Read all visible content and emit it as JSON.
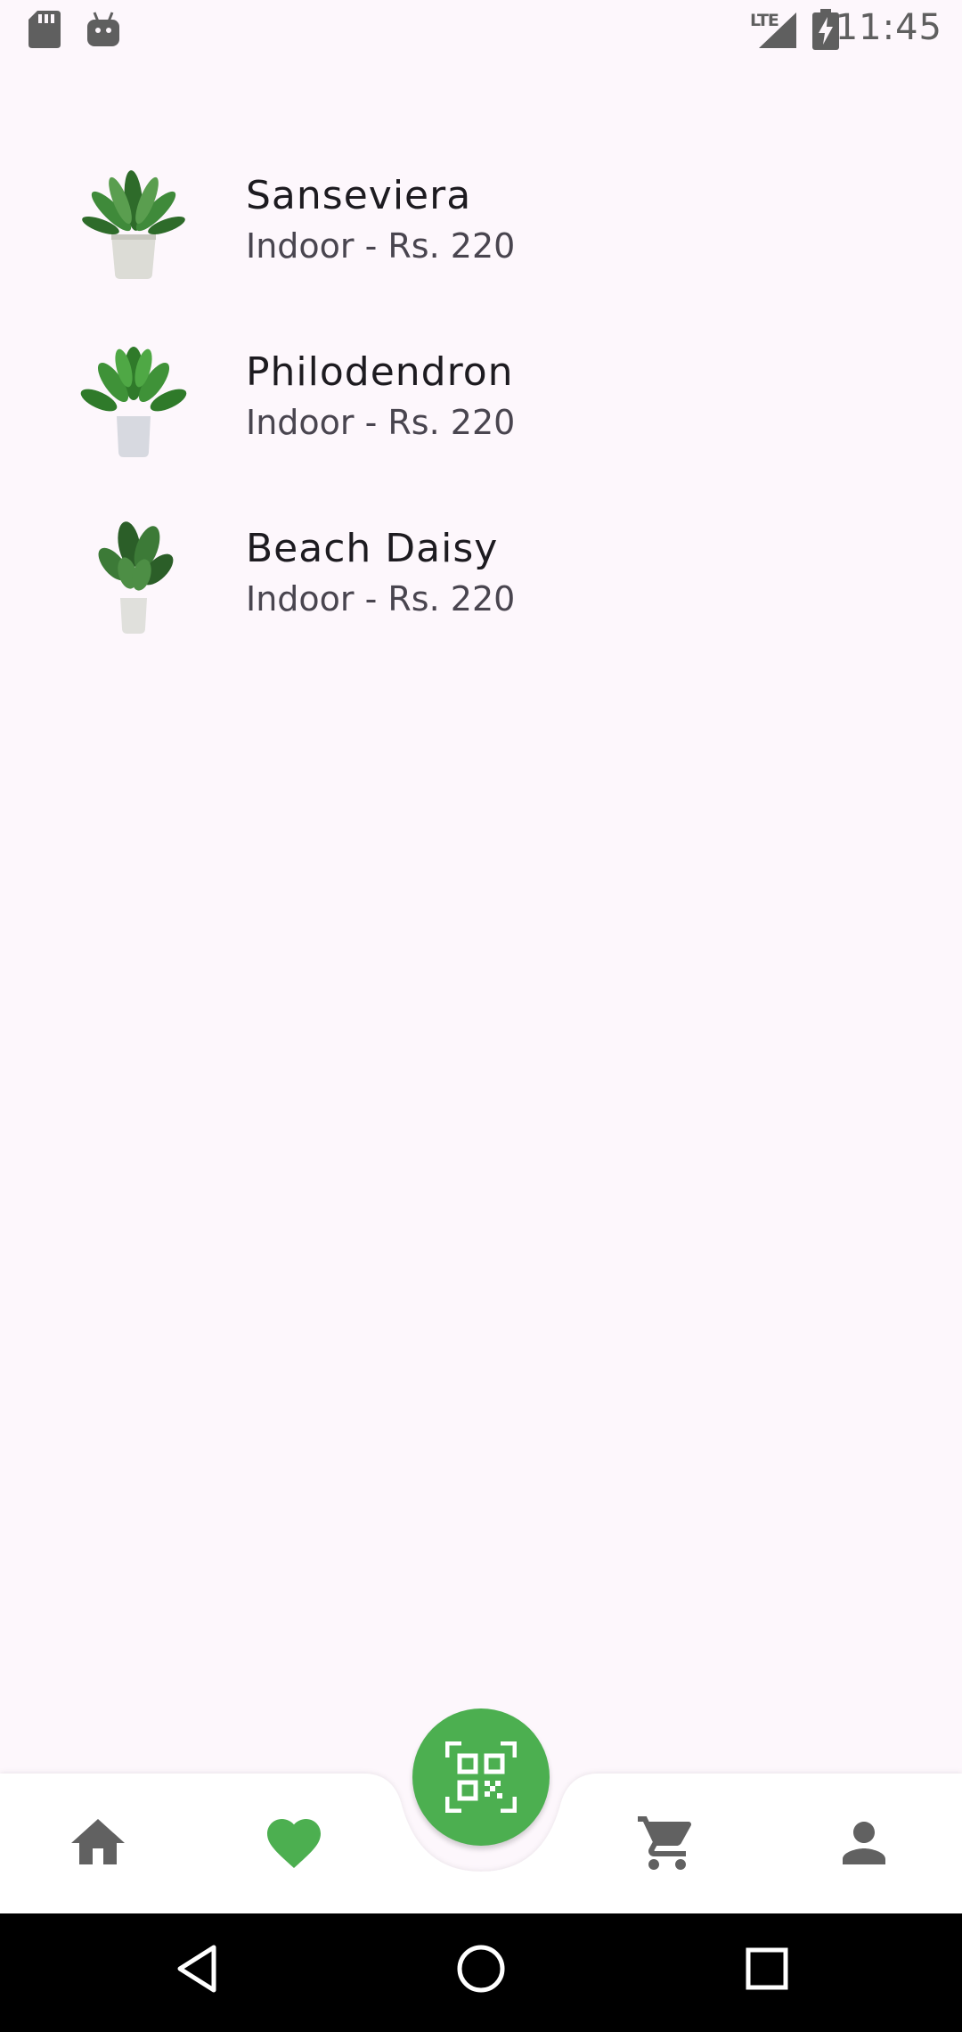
{
  "status_bar": {
    "time": "11:45",
    "network_label": "LTE",
    "icons": [
      "sd-card-icon",
      "android-debug-icon",
      "signal-icon",
      "battery-charging-icon"
    ]
  },
  "favorites": [
    {
      "name": "Sanseviera",
      "subtitle": "Indoor - Rs. 220",
      "image": "potted-plant-image"
    },
    {
      "name": "Philodendron",
      "subtitle": "Indoor - Rs. 220",
      "image": "potted-plant-image"
    },
    {
      "name": "Beach Daisy",
      "subtitle": "Indoor - Rs. 220",
      "image": "potted-plant-image"
    }
  ],
  "bottom_nav": {
    "items": [
      "home-icon",
      "heart-icon",
      "cart-icon",
      "profile-icon"
    ],
    "active": "heart-icon",
    "fab_icon": "qr-scan-icon"
  },
  "colors": {
    "background": "#fdf7fc",
    "accent": "#4caf50",
    "nav_icon": "#616161"
  }
}
